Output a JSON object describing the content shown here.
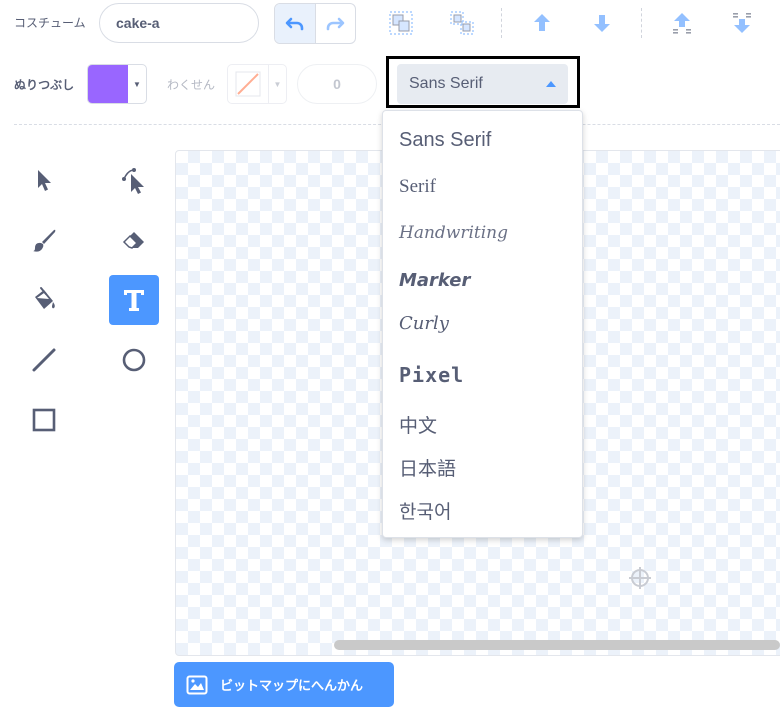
{
  "costume": {
    "label": "コスチューム",
    "name_value": "cake-a"
  },
  "fill": {
    "label": "ぬりつぶし",
    "color": "#9966ff"
  },
  "outline": {
    "label": "わくせん",
    "width_value": "0"
  },
  "font_select": {
    "selected": "Sans Serif",
    "options": [
      "Sans Serif",
      "Serif",
      "Handwriting",
      "Marker",
      "Curly",
      "Pixel",
      "中文",
      "日本語",
      "한국어"
    ]
  },
  "convert_button": {
    "label": "ビットマップにへんかん"
  },
  "colors": {
    "accent": "#4c97ff",
    "text": "#575e75",
    "fill_swatch": "#9966ff"
  },
  "icons": {
    "undo": "undo-icon",
    "redo": "redo-icon",
    "group": "group-icon",
    "ungroup": "ungroup-icon",
    "forward": "forward-icon",
    "backward": "backward-icon",
    "front": "front-icon",
    "back": "back-icon"
  }
}
